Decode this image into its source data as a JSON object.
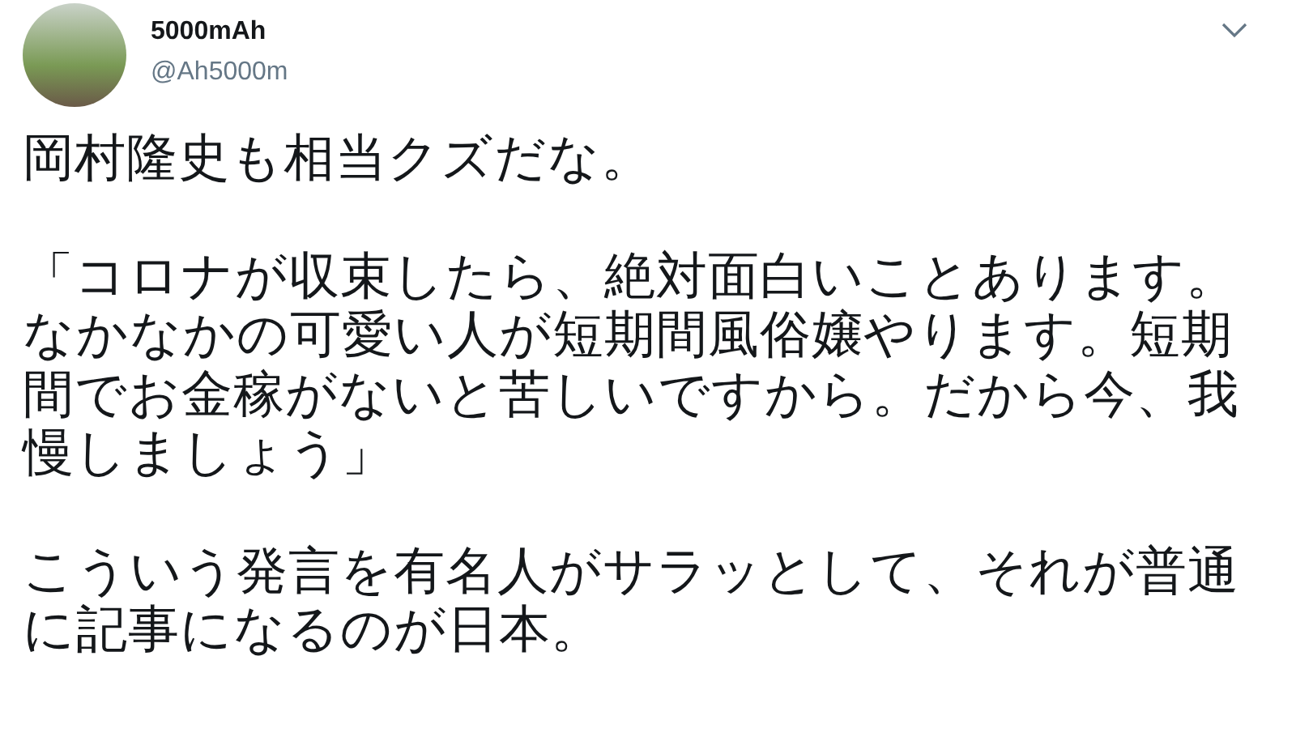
{
  "author": {
    "name": "5000mAh",
    "handle": "@Ah5000m"
  },
  "paragraphs": [
    "岡村隆史も相当クズだな。",
    "「コロナが収束したら、絶対面白いことあります。なかなかの可愛い人が短期間風俗嬢やります。短期間でお金稼がないと苦しいですから。だから今、我慢しましょう」",
    "こういう発言を有名人がサラッとして、それが普通に記事になるのが日本。"
  ]
}
